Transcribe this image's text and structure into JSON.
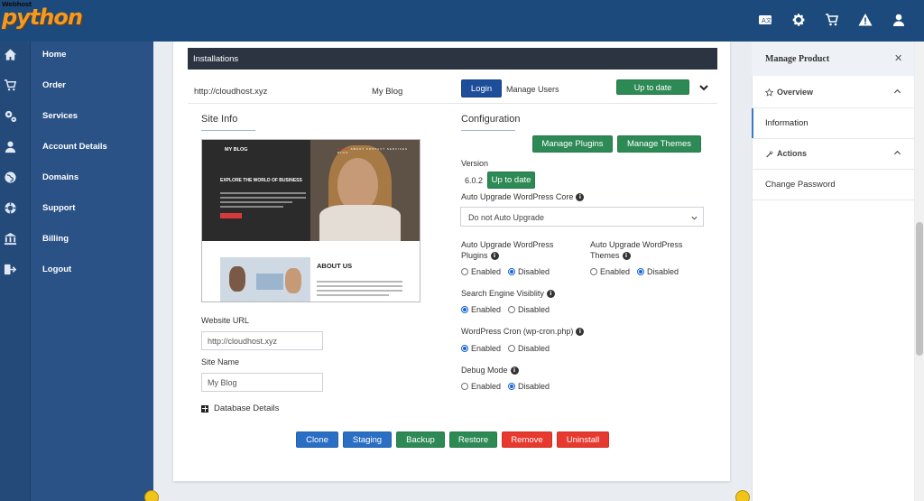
{
  "brand": {
    "small": "Webhost",
    "main": "python"
  },
  "topbar": {
    "icons": [
      "translate-icon",
      "gear-icon",
      "cart-icon",
      "alert-icon",
      "user-icon"
    ]
  },
  "sidebar": {
    "items": [
      {
        "label": "Home",
        "icon": "home-icon"
      },
      {
        "label": "Order",
        "icon": "cart-icon"
      },
      {
        "label": "Services",
        "icon": "gears-icon"
      },
      {
        "label": "Account Details",
        "icon": "user-icon"
      },
      {
        "label": "Domains",
        "icon": "globe-icon"
      },
      {
        "label": "Support",
        "icon": "lifebuoy-icon"
      },
      {
        "label": "Billing",
        "icon": "bank-icon"
      },
      {
        "label": "Logout",
        "icon": "logout-icon"
      }
    ]
  },
  "installations": {
    "header": "Installations",
    "url": "http://cloudhost.xyz",
    "blog": "My Blog",
    "login_label": "Login",
    "manage_users": "Manage Users",
    "status_label": "Up to date"
  },
  "site_info": {
    "title": "Site Info",
    "preview": {
      "logo": "MY BLOG",
      "nav": [
        "HOME",
        "ABOUT",
        "CONTACT",
        "SERVICES",
        "BLOG"
      ],
      "headline": "EXPLORE THE WORLD OF BUSINESS",
      "about": "ABOUT US"
    },
    "website_url_label": "Website URL",
    "website_url_placeholder": "http://cloudhost.xyz",
    "site_name_label": "Site Name",
    "site_name_placeholder": "My Blog",
    "db_details": "Database Details"
  },
  "configuration": {
    "title": "Configuration",
    "manage_plugins": "Manage Plugins",
    "manage_themes": "Manage Themes",
    "version_label": "Version",
    "version_value": "6.0.2",
    "version_status": "Up to date",
    "auto_upgrade_core_label": "Auto Upgrade WordPress Core",
    "auto_upgrade_core_value": "Do not Auto Upgrade",
    "auto_upgrade_plugins_label_1": "Auto Upgrade WordPress",
    "auto_upgrade_plugins_label_2": "Plugins",
    "auto_upgrade_themes_label_1": "Auto Upgrade WordPress",
    "auto_upgrade_themes_label_2": "Themes",
    "search_engine_label": "Search Engine Visiblity",
    "cron_label": "WordPress Cron (wp-cron.php)",
    "debug_label": "Debug Mode",
    "enabled": "Enabled",
    "disabled": "Disabled"
  },
  "actions": {
    "clone": "Clone",
    "staging": "Staging",
    "backup": "Backup",
    "restore": "Restore",
    "remove": "Remove",
    "uninstall": "Uninstall"
  },
  "right_panel": {
    "title": "Manage Product",
    "overview": "Overview",
    "information": "Information",
    "actions": "Actions",
    "change_password": "Change Password"
  },
  "colors": {
    "topbar": "#1c4a7c",
    "sidebar": "#2a5286",
    "green": "#2d8a55",
    "blue": "#2a6fc4",
    "red": "#e8392e",
    "dark_header": "#2c3442"
  }
}
